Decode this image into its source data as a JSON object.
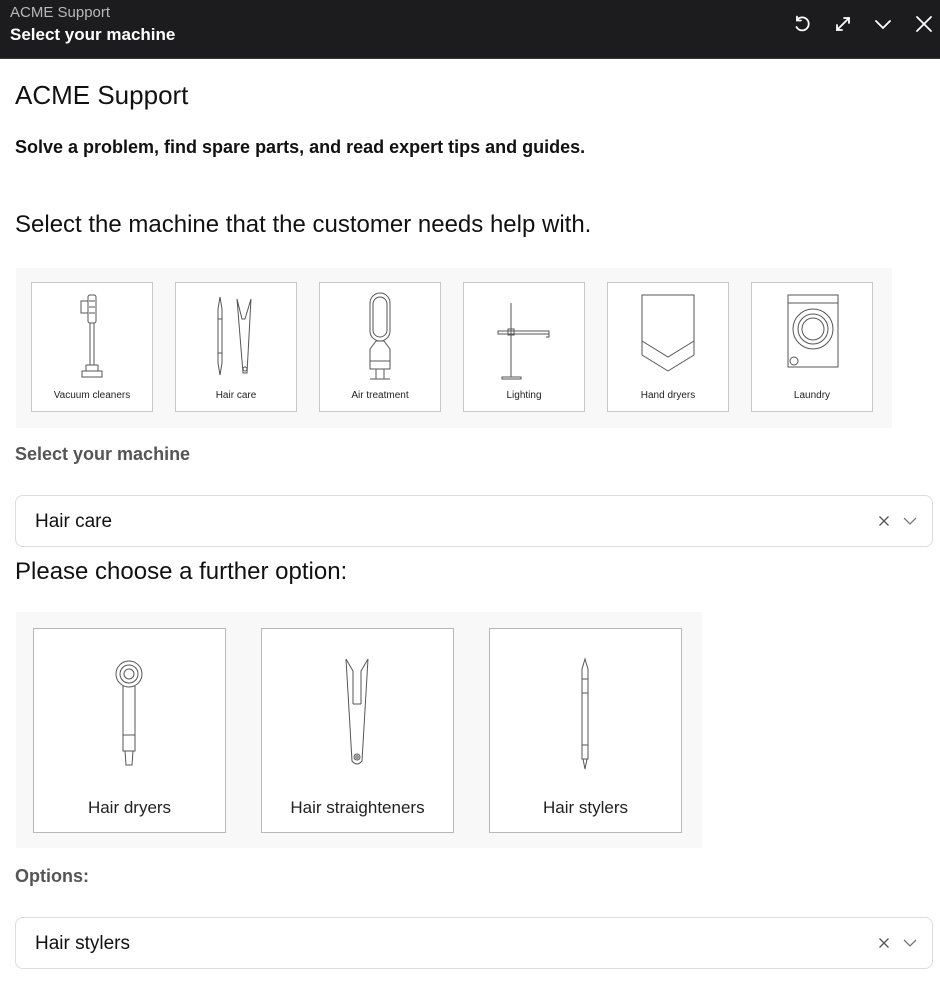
{
  "window": {
    "app_name": "ACME Support",
    "title": "Select your machine",
    "controls": [
      {
        "name": "refresh-icon"
      },
      {
        "name": "expand-icon"
      },
      {
        "name": "collapse-icon"
      },
      {
        "name": "close-icon"
      }
    ]
  },
  "header": {
    "title": "ACME Support",
    "subtitle": "Solve a problem, find spare parts, and read expert tips and guides."
  },
  "machine_section": {
    "heading": "Select the machine that the customer needs help with.",
    "machines": [
      {
        "label": "Vacuum cleaners",
        "icon": "vacuum-icon"
      },
      {
        "label": "Hair care",
        "icon": "hair-care-icon"
      },
      {
        "label": "Air treatment",
        "icon": "air-purifier-icon"
      },
      {
        "label": "Lighting",
        "icon": "lamp-icon"
      },
      {
        "label": "Hand dryers",
        "icon": "hand-dryer-icon"
      },
      {
        "label": "Laundry",
        "icon": "washing-machine-icon"
      }
    ],
    "select_label": "Select your machine",
    "selected_value": "Hair care"
  },
  "option_section": {
    "heading": "Please choose a further option:",
    "options": [
      {
        "label": "Hair dryers",
        "icon": "hair-dryer-icon"
      },
      {
        "label": "Hair straighteners",
        "icon": "hair-straightener-icon"
      },
      {
        "label": "Hair stylers",
        "icon": "hair-styler-icon"
      }
    ],
    "select_label": "Options:",
    "selected_value": "Hair stylers"
  }
}
